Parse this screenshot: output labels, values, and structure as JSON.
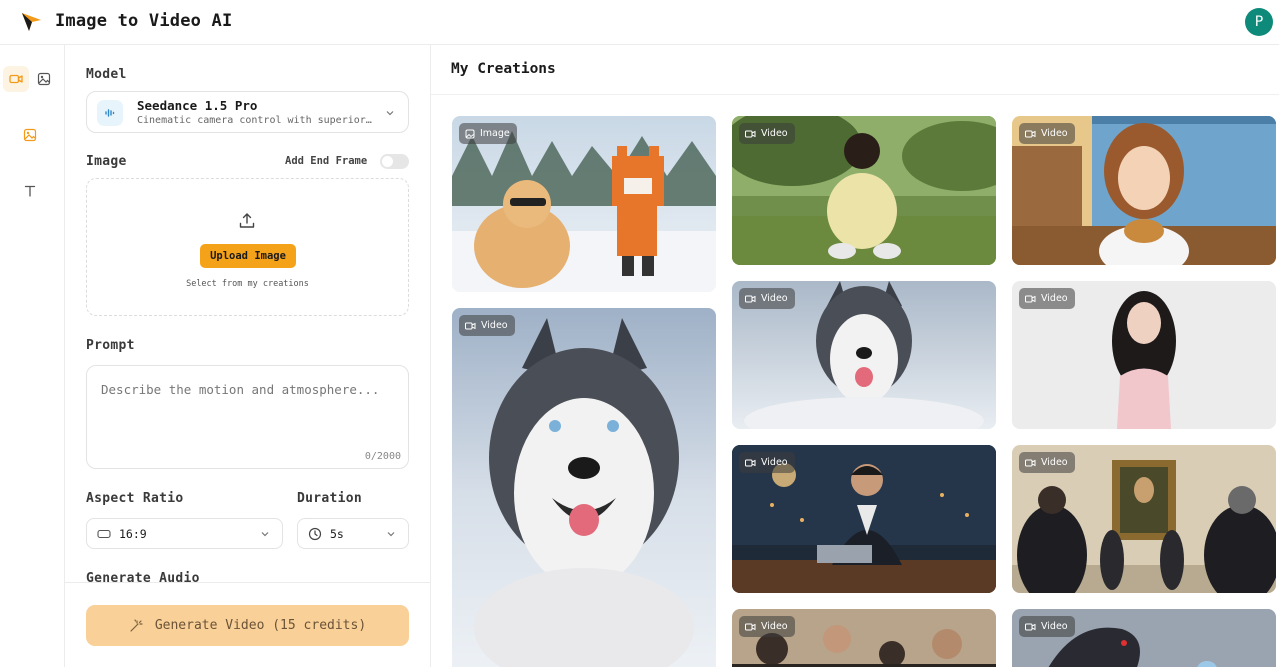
{
  "app": {
    "title": "Image to Video AI",
    "avatar_initial": "P"
  },
  "rail": [
    {
      "name": "video",
      "icon": "video-camera-icon",
      "active": true
    },
    {
      "name": "image",
      "icon": "image-icon",
      "active": false
    },
    {
      "name": "image-alt",
      "icon": "image-icon",
      "active": false
    },
    {
      "name": "text",
      "icon": "text-icon",
      "active": false
    }
  ],
  "panel": {
    "model_label": "Model",
    "model": {
      "name": "Seedance 1.5 Pro",
      "description": "Cinematic camera control with superior motion"
    },
    "image_label": "Image",
    "add_end_frame_label": "Add End Frame",
    "add_end_frame_on": false,
    "upload_button": "Upload Image",
    "upload_sub": "Select from my creations",
    "prompt_label": "Prompt",
    "prompt_placeholder": "Describe the motion and atmosphere...",
    "prompt_counter": "0/2000",
    "aspect_label": "Aspect Ratio",
    "aspect_value": "16:9",
    "duration_label": "Duration",
    "duration_value": "5s",
    "audio_label": "Generate Audio",
    "generate_button": "Generate Video (15 credits)"
  },
  "main": {
    "title": "My Creations",
    "items": [
      {
        "type": "Image",
        "subject": "cat-and-pixel-fox"
      },
      {
        "type": "Video",
        "subject": "girl-tying-shoes"
      },
      {
        "type": "Video",
        "subject": "cartoon-girl-burger"
      },
      {
        "type": "Video",
        "subject": "husky-running"
      },
      {
        "type": "Video",
        "subject": "husky-running-2"
      },
      {
        "type": "Video",
        "subject": "woman-portrait"
      },
      {
        "type": "Video",
        "subject": "man-at-laptop"
      },
      {
        "type": "Video",
        "subject": "museum-mona-lisa"
      },
      {
        "type": "Video",
        "subject": "meeting-crowd"
      },
      {
        "type": "Video",
        "subject": "dark-dragon"
      }
    ]
  },
  "colors": {
    "accent": "#f5a21b",
    "avatar": "#0e8a7a",
    "generate_disabled": "#f9d097"
  }
}
